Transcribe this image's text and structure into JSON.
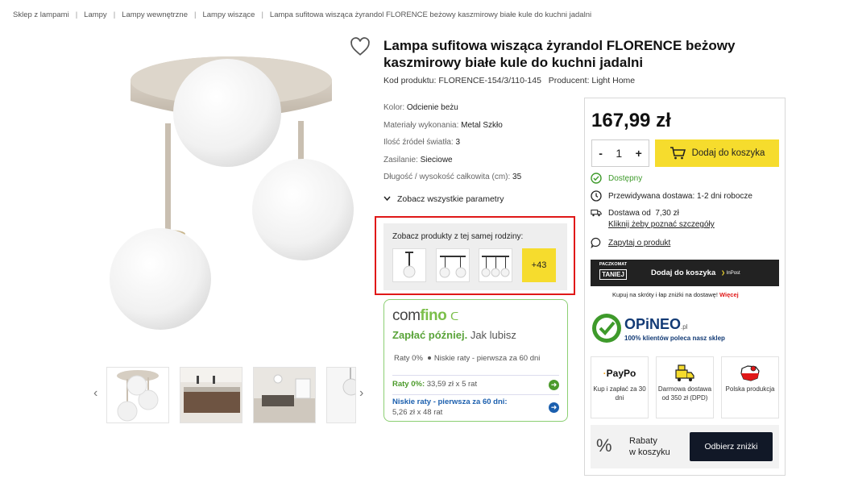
{
  "breadcrumb": [
    "Sklep z lampami",
    "Lampy",
    "Lampy wewnętrzne",
    "Lampy wiszące",
    "Lampa sufitowa wisząca żyrandol FLORENCE beżowy kaszmirowy białe kule do kuchni jadalni"
  ],
  "product": {
    "title": "Lampa sufitowa wisząca żyrandol FLORENCE beżowy kaszmirowy białe kule do kuchni jadalni",
    "code_label": "Kod produktu:",
    "code": "FLORENCE-154/3/110-145",
    "producer_label": "Producent:",
    "producer": "Light Home"
  },
  "params": [
    {
      "label": "Kolor:",
      "value": "Odcienie beżu"
    },
    {
      "label": "Materiały wykonania:",
      "value": "Metal Szkło"
    },
    {
      "label": "Ilość źródeł światła:",
      "value": "3"
    },
    {
      "label": "Zasilanie:",
      "value": "Sieciowe"
    },
    {
      "label": "Długość / wysokość całkowita (cm):",
      "value": "35"
    }
  ],
  "see_all": "Zobacz wszystkie parametry",
  "family": {
    "label": "Zobacz produkty z tej samej rodziny:",
    "more": "+43"
  },
  "comfino": {
    "logo_a": "com",
    "logo_b": "fino",
    "slogan_a": "Zapłać później.",
    "slogan_b": "Jak lubisz",
    "opt1": "Raty 0%",
    "opt2": "Niskie raty - pierwsza za 60 dni",
    "rate1_title": "Raty 0%:",
    "rate1_value": "33,59 zł x 5 rat",
    "rate2_title": "Niskie raty - pierwsza za 60 dni:",
    "rate2_value": "5,26 zł x 48 rat"
  },
  "buy": {
    "price": "167,99 zł",
    "qty_minus": "-",
    "qty": "1",
    "qty_plus": "+",
    "add_to_cart": "Dodaj do koszyka",
    "available": "Dostępny",
    "delivery_time": "Przewidywana dostawa: 1-2 dni robocze",
    "delivery_from_label": "Dostawa od",
    "delivery_from": "7,30 zł",
    "delivery_link": "Kliknij żeby poznać szczegóły",
    "ask": "Zapytaj o produkt"
  },
  "paczkomat": {
    "logo_top": "PACZKOMAT",
    "logo_big": "TANIEJ",
    "text": "Dodaj do koszyka",
    "inpost": "InPost",
    "note": "Kupuj na skróty i łap zniżki na dostawę!",
    "note_link": "Więcej"
  },
  "opineo": {
    "brand": "OPiNEO",
    "pl": ".pl",
    "tag": "100% klientów poleca nasz sklep"
  },
  "features": [
    {
      "title": "PayPo",
      "text": "Kup i zapłać za 30 dni"
    },
    {
      "title": "",
      "text": "Darmowa dostawa od 350 zł (DPD)"
    },
    {
      "title": "",
      "text": "Polska produkcja"
    }
  ],
  "discount": {
    "text_1": "Rabaty",
    "text_2": "w koszyku",
    "button": "Odbierz zniżki"
  },
  "colors": {
    "yellow": "#f6dc2d",
    "green": "#5aa43a",
    "red_outline": "#e01818",
    "opineo_blue": "#123a75",
    "dark_button": "#111827"
  }
}
